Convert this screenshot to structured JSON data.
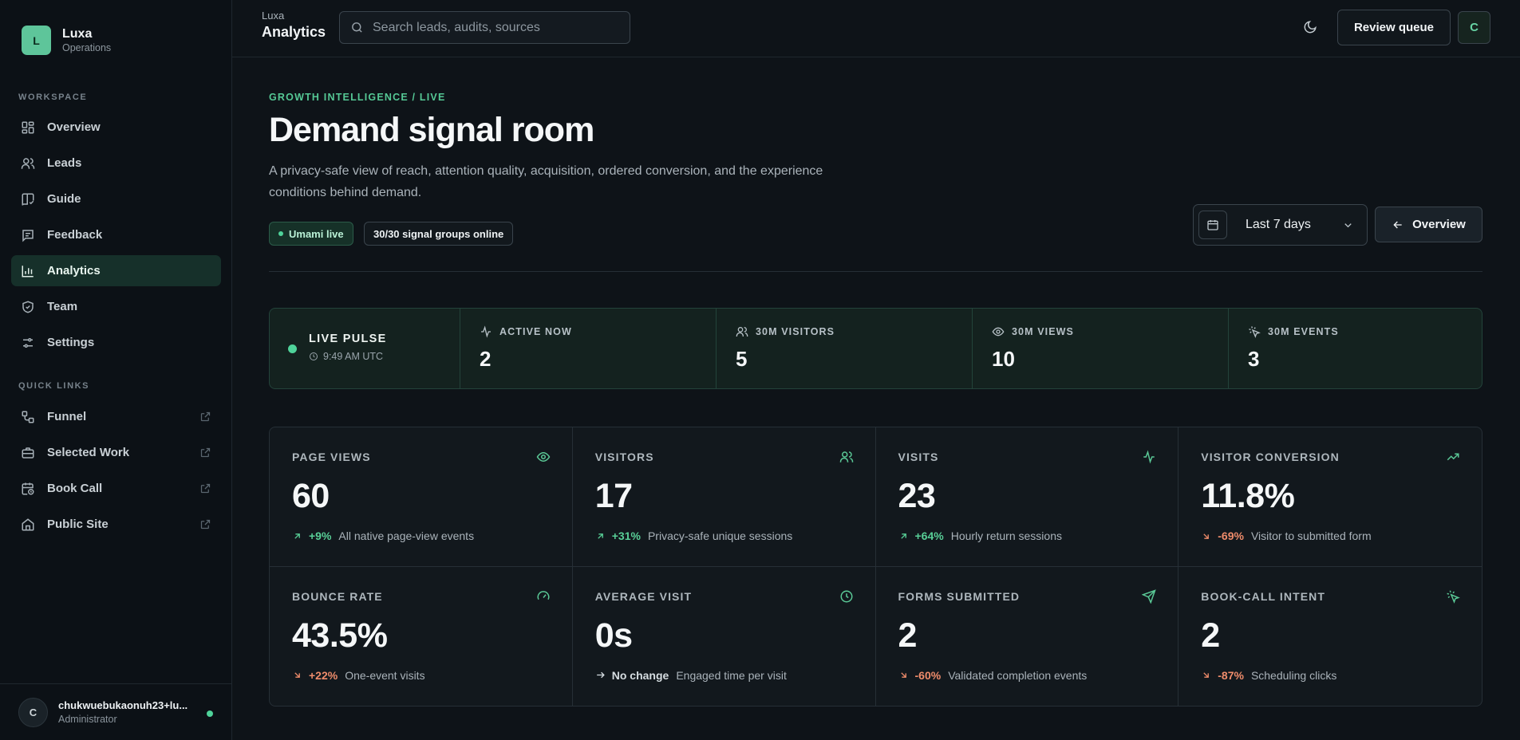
{
  "brand": {
    "logo_letter": "L",
    "name": "Luxa",
    "subtitle": "Operations"
  },
  "sidebar": {
    "workspace_label": "WORKSPACE",
    "items": [
      {
        "label": "Overview",
        "icon": "grid-icon"
      },
      {
        "label": "Leads",
        "icon": "users-icon"
      },
      {
        "label": "Guide",
        "icon": "book-icon"
      },
      {
        "label": "Feedback",
        "icon": "message-icon"
      },
      {
        "label": "Analytics",
        "icon": "bar-chart-icon",
        "active": true
      },
      {
        "label": "Team",
        "icon": "shield-icon"
      },
      {
        "label": "Settings",
        "icon": "sliders-icon"
      }
    ],
    "quick_links_label": "QUICK LINKS",
    "quick_links": [
      {
        "label": "Funnel",
        "icon": "workflow-icon"
      },
      {
        "label": "Selected Work",
        "icon": "briefcase-icon"
      },
      {
        "label": "Book Call",
        "icon": "calendar-clock-icon"
      },
      {
        "label": "Public Site",
        "icon": "home-icon"
      }
    ]
  },
  "user": {
    "initial": "C",
    "name": "chukwuebukaonuh23+lu...",
    "role": "Administrator",
    "status_color": "#4fd39a"
  },
  "topbar": {
    "small_title": "Luxa",
    "big_title": "Analytics",
    "search_placeholder": "Search leads, audits, sources",
    "review_label": "Review queue",
    "avatar_initial": "C"
  },
  "header": {
    "eyebrow": "GROWTH INTELLIGENCE / LIVE",
    "title": "Demand signal room",
    "description": "A privacy-safe view of reach, attention quality, acquisition, ordered conversion, and the experience conditions behind demand.",
    "badge_live": "Umami live",
    "badge_groups": "30/30 signal groups online",
    "date_range": "Last 7 days",
    "overview_label": "Overview"
  },
  "pulse": {
    "title": "LIVE PULSE",
    "time": "9:49 AM UTC",
    "metrics": [
      {
        "label": "ACTIVE NOW",
        "value": "2",
        "icon": "activity-icon"
      },
      {
        "label": "30M VISITORS",
        "value": "5",
        "icon": "users-icon"
      },
      {
        "label": "30M VIEWS",
        "value": "10",
        "icon": "eye-icon"
      },
      {
        "label": "30M EVENTS",
        "value": "3",
        "icon": "pointer-click-icon"
      }
    ]
  },
  "kpis": [
    {
      "label": "PAGE VIEWS",
      "value": "60",
      "delta": "+9%",
      "trend": "up",
      "note": "All native page-view events",
      "icon": "eye-icon"
    },
    {
      "label": "VISITORS",
      "value": "17",
      "delta": "+31%",
      "trend": "up",
      "note": "Privacy-safe unique sessions",
      "icon": "users-icon"
    },
    {
      "label": "VISITS",
      "value": "23",
      "delta": "+64%",
      "trend": "up",
      "note": "Hourly return sessions",
      "icon": "activity-icon"
    },
    {
      "label": "VISITOR CONVERSION",
      "value": "11.8%",
      "delta": "-69%",
      "trend": "down",
      "note": "Visitor to submitted form",
      "icon": "trending-up-icon"
    },
    {
      "label": "BOUNCE RATE",
      "value": "43.5%",
      "delta": "+22%",
      "trend": "down",
      "note": "One-event visits",
      "icon": "gauge-icon"
    },
    {
      "label": "AVERAGE VISIT",
      "value": "0s",
      "delta": "No change",
      "trend": "flat",
      "note": "Engaged time per visit",
      "icon": "clock-icon"
    },
    {
      "label": "FORMS SUBMITTED",
      "value": "2",
      "delta": "-60%",
      "trend": "down",
      "note": "Validated completion events",
      "icon": "send-icon"
    },
    {
      "label": "BOOK-CALL INTENT",
      "value": "2",
      "delta": "-87%",
      "trend": "down",
      "note": "Scheduling clicks",
      "icon": "pointer-click-icon"
    }
  ],
  "colors": {
    "accent": "#5ac896",
    "positive": "#58cf97",
    "negative": "#ef8c6b",
    "background": "#0e1318"
  }
}
